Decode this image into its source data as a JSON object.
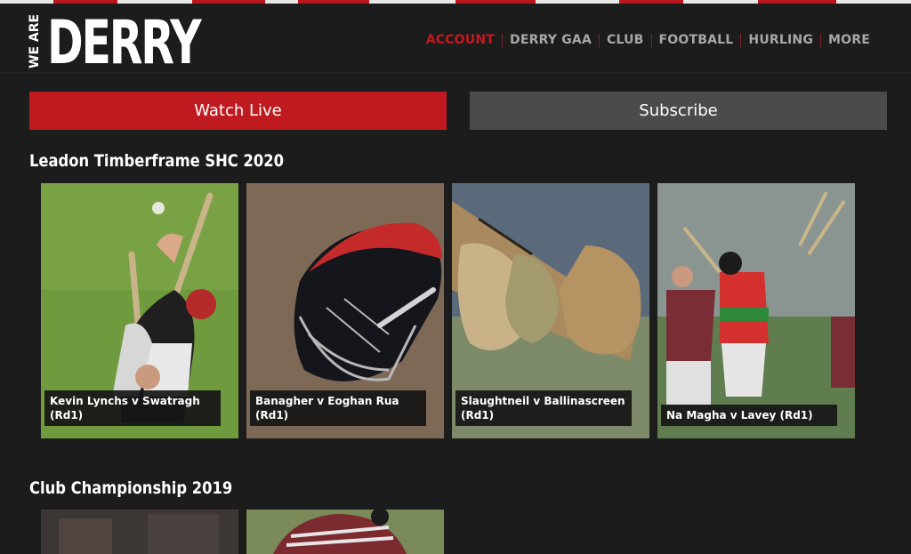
{
  "header": {
    "logo_small": "WE ARE",
    "logo_big": "DERRY",
    "nav": [
      {
        "label": "ACCOUNT",
        "active": true
      },
      {
        "label": "DERRY GAA",
        "active": false
      },
      {
        "label": "CLUB",
        "active": false
      },
      {
        "label": "FOOTBALL",
        "active": false
      },
      {
        "label": "HURLING",
        "active": false
      },
      {
        "label": "MORE",
        "active": false
      }
    ]
  },
  "buttons": {
    "watch_live": "Watch Live",
    "subscribe": "Subscribe"
  },
  "sections": [
    {
      "title": "Leadon Timberframe SHC 2020",
      "videos": [
        {
          "caption": "Kevin Lynchs v Swatragh (Rd1)"
        },
        {
          "caption": "Banagher v Eoghan Rua (Rd1)"
        },
        {
          "caption": "Slaughtneil v Ballinascreen (Rd1)"
        },
        {
          "caption": "Na Magha v Lavey (Rd1)"
        }
      ]
    },
    {
      "title": "Club Championship 2019",
      "videos": []
    }
  ],
  "colors": {
    "accent": "#bf1a20",
    "background": "#1d1c1c",
    "secondary_button": "#4a4b4d",
    "nav_text": "#a7a7a7"
  }
}
